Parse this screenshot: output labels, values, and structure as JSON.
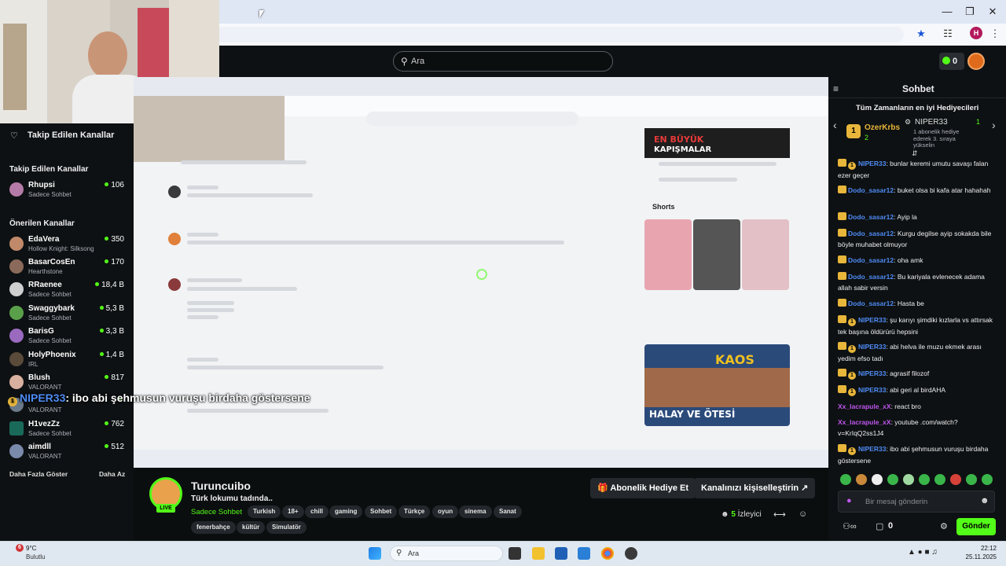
{
  "search": {
    "placeholder": "Ara"
  },
  "header": {
    "coins": "0"
  },
  "sidebar": {
    "followed_title": "Takip Edilen Kanallar",
    "followed_section": "Takip Edilen Kanallar",
    "followed": [
      {
        "name": "Rhupsi",
        "sub": "Sadece Sohbet",
        "viewers": "106"
      }
    ],
    "recommended_section": "Önerilen Kanallar",
    "recommended": [
      {
        "name": "EdaVera",
        "sub": "Hollow Knight: Silksong",
        "viewers": "350"
      },
      {
        "name": "BasarCosEn",
        "sub": "Hearthstone",
        "viewers": "170"
      },
      {
        "name": "RRaenee",
        "sub": "Sadece Sohbet",
        "viewers": "18,4 B"
      },
      {
        "name": "Swaggybark",
        "sub": "Sadece Sohbet",
        "viewers": "5,3 B"
      },
      {
        "name": "BarisG",
        "sub": "Sadece Sohbet",
        "viewers": "3,3 B"
      },
      {
        "name": "HolyPhoenix",
        "sub": "IRL",
        "viewers": "1,4 B"
      },
      {
        "name": "Blush",
        "sub": "VALORANT",
        "viewers": "817"
      },
      {
        "name": "",
        "sub": "VALORANT",
        "viewers": ""
      },
      {
        "name": "H1vezZz",
        "sub": "Sadece Sohbet",
        "viewers": "762"
      },
      {
        "name": "aimdll",
        "sub": "VALORANT",
        "viewers": "512"
      }
    ],
    "show_more": "Daha Fazla Göster",
    "show_less": "Daha Az"
  },
  "video": {
    "overlay_user": "NIPER33",
    "overlay_text": ": ibo abi şehmusun vuruşu birdaha göstersene",
    "yt_header1": "EN BÜYÜK",
    "yt_header2": "KAPIŞMALAR",
    "yt_shorts": "Shorts",
    "yt_thumb_text": "HALAY VE ÖTESİ",
    "yt_kaos": "KAOS"
  },
  "stream": {
    "streamer": "Turuncuibo",
    "title": "Türk lokumu tadında..",
    "category": "Sadece Sohbet",
    "live": "LIVE",
    "tags": [
      "Turkish",
      "18+",
      "chill",
      "gaming",
      "Sohbet",
      "Türkçe",
      "oyun",
      "sinema",
      "Sanat",
      "fenerbahçe",
      "kültür",
      "Simulatör"
    ],
    "gift_button": "Abonelik Hediye Et",
    "customize_button": "Kanalınızı kişiselleştirin",
    "viewers_count": "5",
    "viewers_label": "İzleyici"
  },
  "chat": {
    "title": "Sohbet",
    "top_gifters_title": "Tüm Zamanların en iyi Hediyecileri",
    "gifter1_name": "OzerKrbs",
    "gifter1_count": "2",
    "gifter2_name": "NIPER33",
    "gifter2_count": "1",
    "gifter2_note": "1 abonelik hediye ederek 3. sıraya yükselin",
    "messages": [
      {
        "user": "NIPER33",
        "text": ": bunlar keremi umutu savaşı falan ezer geçer"
      },
      {
        "user": "Dodo_sasar12",
        "text": ": buket olsa bi kafa atar hahahah"
      },
      {
        "user": "Dodo_sasar12",
        "text": ": Ayip la"
      },
      {
        "user": "Dodo_sasar12",
        "text": ": Kurgu degilse ayip sokakda bile böyle muhabet olmuyor"
      },
      {
        "user": "Dodo_sasar12",
        "text": ": oha amk"
      },
      {
        "user": "Dodo_sasar12",
        "text": ": Bu kariyala evlenecek adama allah sabir versin"
      },
      {
        "user": "Dodo_sasar12",
        "text": ": Hasta be"
      },
      {
        "user": "NIPER33",
        "text": ": şu karıyı şimdiki kızlarla vs attırsak tek başına öldürürü hepsini"
      },
      {
        "user": "NIPER33",
        "text": ": abi helva ile muzu ekmek arası yedim efso tadı"
      },
      {
        "user": "NIPER33",
        "text": ": agrasif filozof"
      },
      {
        "user": "NIPER33",
        "text": ": abi geri al birdAHA"
      },
      {
        "user": "Xx_lacrapule_xX",
        "text": ": react bro"
      },
      {
        "user": "Xx_lacrapule_xX",
        "text": ": youtube .com/watch?v=KrIqQ2ss1J4"
      },
      {
        "user": "NIPER33",
        "text": ": ibo abi şehmusun vuruşu birdaha göstersene"
      }
    ],
    "input_placeholder": "Bir mesaj gönderin",
    "kick_count": "0",
    "send_button": "Gönder"
  },
  "taskbar": {
    "weather_badge": "6",
    "temp": "9°C",
    "weather": "Bulutlu",
    "search": "Ara",
    "time": "22:12",
    "date": "25.11.2025"
  }
}
